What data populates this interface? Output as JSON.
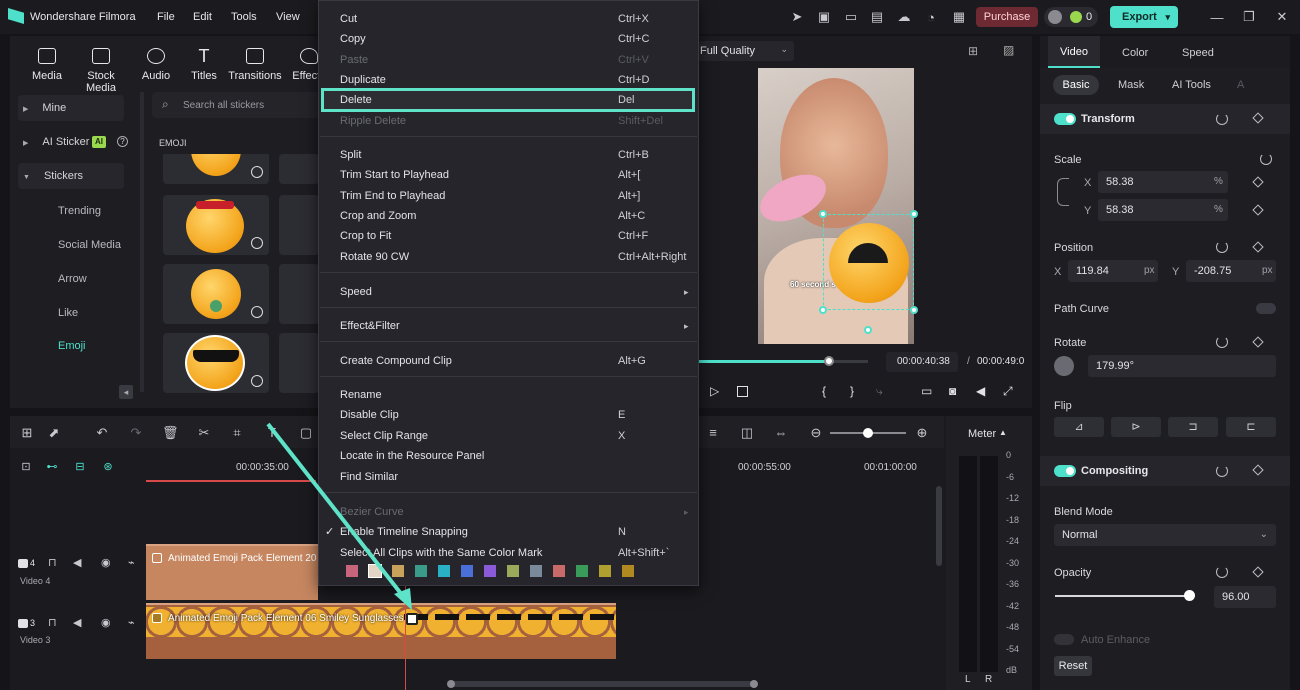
{
  "app": {
    "title": "Wondershare Filmora",
    "menu": [
      "File",
      "Edit",
      "Tools",
      "View"
    ],
    "purchase": "Purchase",
    "credits": "0",
    "export": "Export"
  },
  "toolbar": {
    "items": [
      "Media",
      "Stock Media",
      "Audio",
      "Titles",
      "Transitions",
      "Effects"
    ]
  },
  "sidebar": {
    "mine": "Mine",
    "ai_sticker": "AI Sticker",
    "ai_badge": "AI",
    "stickers": "Stickers",
    "subs": [
      "Trending",
      "Social Media",
      "Arrow",
      "Like",
      "Emoji"
    ]
  },
  "stickers": {
    "search_placeholder": "Search all stickers",
    "section": "EMOJI"
  },
  "preview": {
    "quality": "Full Quality",
    "time_current": "00:00:40:38",
    "time_sep": "/",
    "time_total": "00:00:49:0",
    "caption": "60 second s"
  },
  "context_menu": {
    "items": [
      {
        "label": "Cut",
        "shortcut": "Ctrl+X"
      },
      {
        "label": "Copy",
        "shortcut": "Ctrl+C"
      },
      {
        "label": "Paste",
        "shortcut": "Ctrl+V"
      },
      {
        "label": "Duplicate",
        "shortcut": "Ctrl+D"
      },
      {
        "label": "Delete",
        "shortcut": "Del"
      },
      {
        "label": "Ripple Delete",
        "shortcut": "Shift+Del"
      },
      {
        "label": "Split",
        "shortcut": "Ctrl+B"
      },
      {
        "label": "Trim Start to Playhead",
        "shortcut": "Alt+["
      },
      {
        "label": "Trim End to Playhead",
        "shortcut": "Alt+]"
      },
      {
        "label": "Crop and Zoom",
        "shortcut": "Alt+C"
      },
      {
        "label": "Crop to Fit",
        "shortcut": "Ctrl+F"
      },
      {
        "label": "Rotate 90 CW",
        "shortcut": "Ctrl+Alt+Right"
      },
      {
        "label": "Speed",
        "shortcut": ""
      },
      {
        "label": "Effect&Filter",
        "shortcut": ""
      },
      {
        "label": "Create Compound Clip",
        "shortcut": "Alt+G"
      },
      {
        "label": "Rename",
        "shortcut": ""
      },
      {
        "label": "Disable Clip",
        "shortcut": "E"
      },
      {
        "label": "Select Clip Range",
        "shortcut": "X"
      },
      {
        "label": "Locate in the Resource Panel",
        "shortcut": ""
      },
      {
        "label": "Find Similar",
        "shortcut": ""
      },
      {
        "label": "Bezier Curve",
        "shortcut": ""
      },
      {
        "label": "Enable Timeline Snapping",
        "shortcut": "N"
      },
      {
        "label": "Select All Clips with the Same Color Mark",
        "shortcut": "Alt+Shift+`"
      }
    ],
    "color_marks": [
      "#c8657c",
      "#e3d3c4",
      "#c8a15a",
      "#3a9b8a",
      "#2ab0c5",
      "#4a6fd8",
      "#8a5ad8",
      "#9aaa5a",
      "#7a8a9a",
      "#c86a6a",
      "#3a9a5a",
      "#b0a030",
      "#b08a20"
    ]
  },
  "timeline": {
    "ruler": [
      "00:00:35:00",
      "00:00:55:00",
      "00:01:00:00"
    ],
    "tracks": [
      {
        "num": "4",
        "name": "Video 4",
        "clip": "Animated Emoji Pack Element 20"
      },
      {
        "num": "3",
        "name": "Video 3",
        "clip": "Animated Emoji Pack Element 06 Smiley Sunglasses"
      }
    ],
    "meter_label": "Meter",
    "meter_scale": [
      "0",
      "-6",
      "-12",
      "-18",
      "-24",
      "-30",
      "-36",
      "-42",
      "-48",
      "-54",
      "dB"
    ],
    "meter_channels": [
      "L",
      "R"
    ]
  },
  "inspector": {
    "tabs": [
      "Video",
      "Color",
      "Speed"
    ],
    "subtabs": [
      "Basic",
      "Mask",
      "AI Tools",
      "A"
    ],
    "transform": "Transform",
    "scale": "Scale",
    "scale_x_label": "X",
    "scale_x": "58.38",
    "scale_y_label": "Y",
    "scale_y": "58.38",
    "percent": "%",
    "position": "Position",
    "pos_x_label": "X",
    "pos_x": "119.84",
    "pos_y_label": "Y",
    "pos_y": "-208.75",
    "px": "px",
    "path_curve": "Path Curve",
    "rotate": "Rotate",
    "rotate_value": "179.99°",
    "flip": "Flip",
    "compositing": "Compositing",
    "blend_mode": "Blend Mode",
    "blend_value": "Normal",
    "opacity": "Opacity",
    "opacity_value": "96.00",
    "auto_enhance": "Auto Enhance",
    "reset": "Reset"
  }
}
